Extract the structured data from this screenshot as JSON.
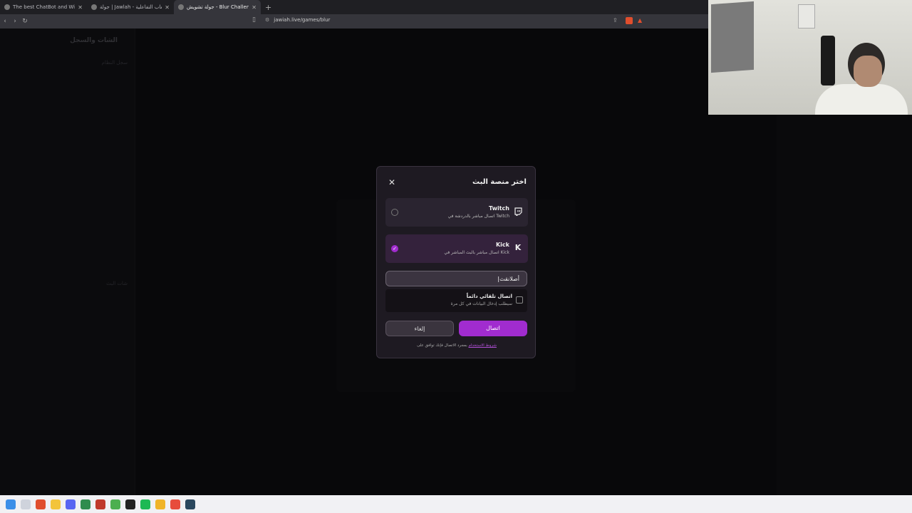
{
  "browser": {
    "tabs": [
      {
        "title": "The best ChatBot and Widgets for K",
        "active": false
      },
      {
        "title": "جولة | Jawlah - منصة الألعاب التفاعلية",
        "active": false
      },
      {
        "title": "جولة تشويش - Blur Challenge |",
        "active": true
      }
    ],
    "new_tab": "+",
    "url": "jawiah.live/games/blur"
  },
  "page": {
    "sidebar_title": "الشات والسجل",
    "sidebar_row1": "سجل النظام",
    "sidebar_row2": "شات البث"
  },
  "modal": {
    "title": "اختر منصة البث",
    "close_icon": "close-icon",
    "platforms": [
      {
        "name": "Twitch",
        "desc": "اتصال مباشر بالدردشة في Twitch",
        "icon": "twitch-icon",
        "selected": false
      },
      {
        "name": "Kick",
        "desc": "اتصال مباشر بالبث المباشر في Kick",
        "icon": "kick-icon",
        "selected": true
      }
    ],
    "channel_input_value": "أصلانقث",
    "auto_connect_label": "اتصال تلقائي دائماً",
    "auto_connect_desc": "سيطلب إدخال البيانات في كل مرة",
    "connect_label": "اتصال",
    "cancel_label": "إلغاء",
    "footer_text": "بمجرد الاتصال فإنك توافق على",
    "footer_link": "شروط الاستخدام"
  },
  "colors": {
    "accent": "#a12ccf",
    "modal_bg": "#1e1a22",
    "page_bg": "#0d0d10"
  }
}
